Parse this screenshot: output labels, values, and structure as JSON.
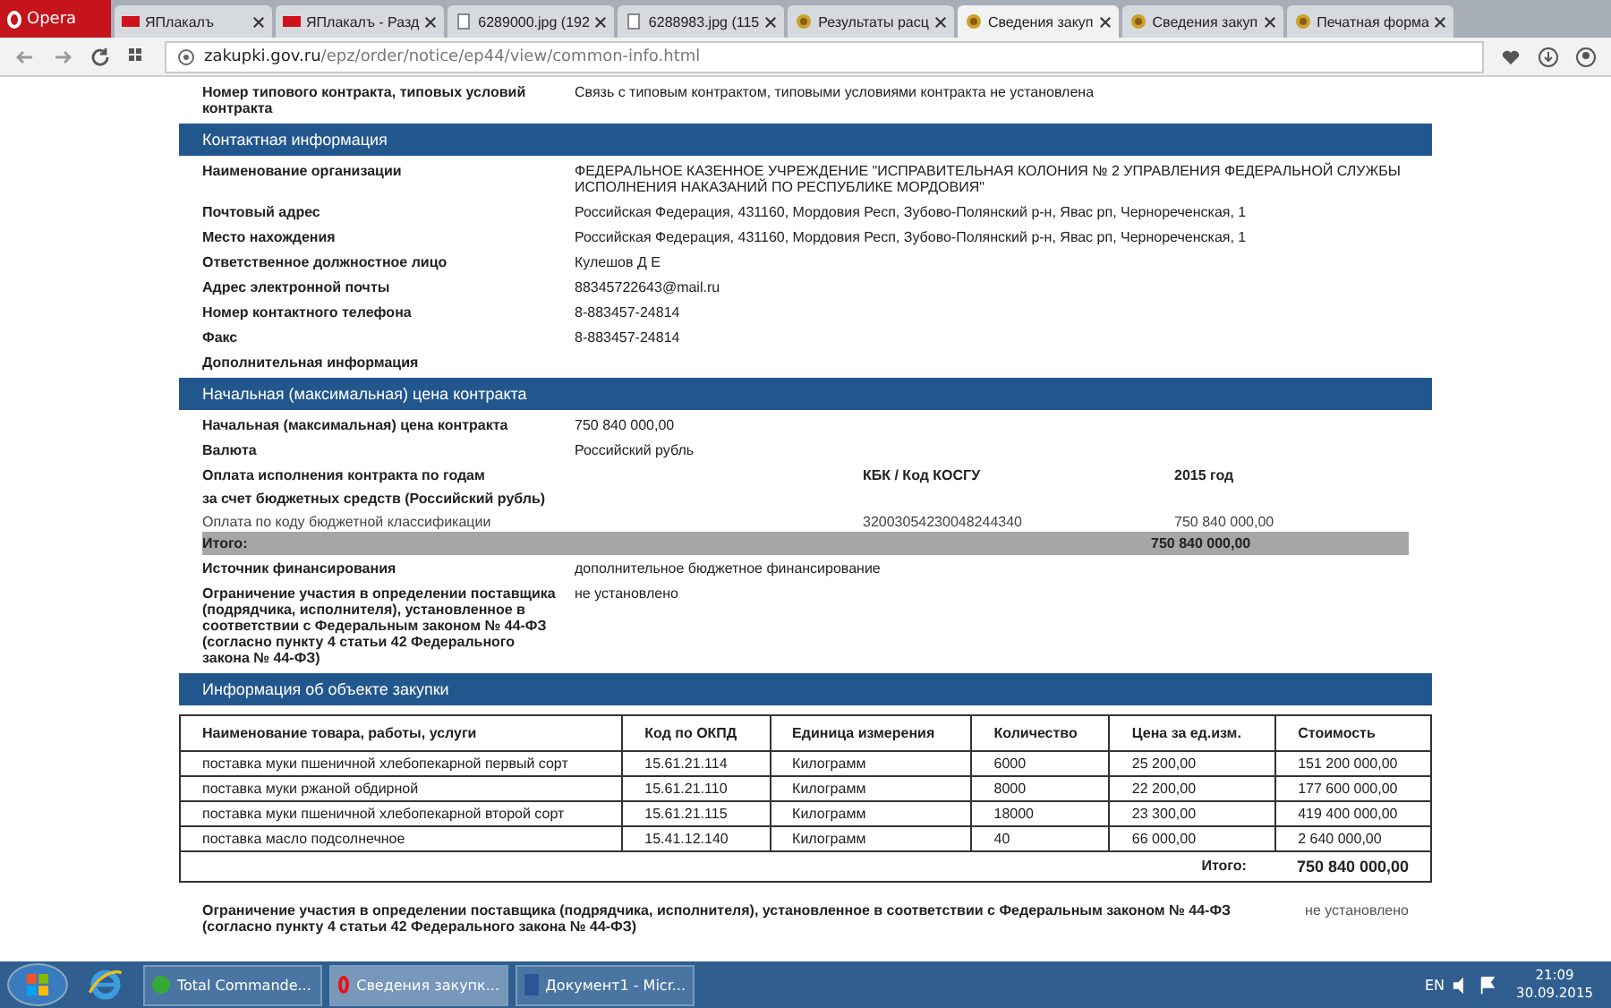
{
  "browser": {
    "menu_label": "Opera",
    "tabs": [
      {
        "label": "ЯПлакалъ",
        "selected": false,
        "kind": "yap"
      },
      {
        "label": "ЯПлакалъ - Разд",
        "selected": false,
        "kind": "yap"
      },
      {
        "label": "6289000.jpg (192",
        "selected": false,
        "kind": "page"
      },
      {
        "label": "6288983.jpg (115",
        "selected": false,
        "kind": "page"
      },
      {
        "label": "Результаты расц",
        "selected": false,
        "kind": "emblem"
      },
      {
        "label": "Сведения закуп",
        "selected": true,
        "kind": "emblem"
      },
      {
        "label": "Сведения закуп",
        "selected": false,
        "kind": "emblem"
      },
      {
        "label": "Печатная форма",
        "selected": false,
        "kind": "emblem"
      }
    ],
    "url_host": "zakupki.gov.ru",
    "url_path": "/epz/order/notice/ep44/view/common-info.html"
  },
  "top_row": {
    "label": "Номер типового контракта, типовых условий контракта",
    "value": "Связь с типовым контрактом, типовыми условиями контракта не установлена"
  },
  "contact": {
    "title": "Контактная информация",
    "rows": [
      {
        "label": "Наименование организации",
        "value": "ФЕДЕРАЛЬНОЕ КАЗЕННОЕ УЧРЕЖДЕНИЕ \"ИСПРАВИТЕЛЬНАЯ КОЛОНИЯ № 2 УПРАВЛЕНИЯ ФЕДЕРАЛЬНОЙ СЛУЖБЫ ИСПОЛНЕНИЯ НАКАЗАНИЙ ПО РЕСПУБЛИКЕ МОРДОВИЯ\""
      },
      {
        "label": "Почтовый адрес",
        "value": "Российская Федерация, 431160, Мордовия Респ, Зубово-Полянский р-н, Явас рп, Чернореченская, 1"
      },
      {
        "label": "Место нахождения",
        "value": "Российская Федерация, 431160, Мордовия Респ, Зубово-Полянский р-н, Явас рп, Чернореченская, 1"
      },
      {
        "label": "Ответственное должностное лицо",
        "value": "Кулешов Д Е"
      },
      {
        "label": "Адрес электронной почты",
        "value": "88345722643@mail.ru"
      },
      {
        "label": "Номер контактного телефона",
        "value": "8-883457-24814"
      },
      {
        "label": "Факс",
        "value": "8-883457-24814"
      },
      {
        "label": "Дополнительная информация"
      }
    ]
  },
  "price": {
    "title": "Начальная (максимальная) цена контракта",
    "rows": [
      {
        "label": "Начальная (максимальная) цена контракта",
        "value": "750 840 000,00"
      },
      {
        "label": "Валюта",
        "value": "Российский рубль"
      }
    ],
    "payment": {
      "heading": "Оплата исполнения контракта по годам",
      "code_heading": "КБК / Код КОСГУ",
      "year_heading": "2015 год",
      "subheading": "за счет бюджетных средств (Российский рубль)",
      "row": {
        "label": "Оплата по коду бюджетной классификации",
        "code": "32003054230048244340",
        "amount": "750 840 000,00"
      },
      "total_label": "Итого:",
      "total": "750 840 000,00"
    },
    "rows_after": [
      {
        "label": "Источник финансирования",
        "value": "дополнительное бюджетное финансирование"
      },
      {
        "label": "Ограничение участия в определении поставщика (подрядчика, исполнителя), установленное в соответствии с Федеральным законом № 44-ФЗ (согласно пункту 4 статьи 42 Федерального закона № 44-ФЗ)",
        "value": "не установлено"
      }
    ]
  },
  "object": {
    "title": "Информация об объекте закупки",
    "columns": [
      "Наименование товара, работы, услуги",
      "Код по ОКПД",
      "Единица измерения",
      "Количество",
      "Цена за ед.изм.",
      "Стоимость"
    ],
    "rows": [
      [
        "поставка муки пшеничной хлебопекарной первый сорт",
        "15.61.21.114",
        "Килограмм",
        "6000",
        "25 200,00",
        "151 200 000,00"
      ],
      [
        "поставка муки ржаной обдирной",
        "15.61.21.110",
        "Килограмм",
        "8000",
        "22 200,00",
        "177 600 000,00"
      ],
      [
        "поставка муки пшеничной хлебопекарной второй сорт",
        "15.61.21.115",
        "Килограмм",
        "18000",
        "23 300,00",
        "419 400 000,00"
      ],
      [
        "поставка масло подсолнечное",
        "15.41.12.140",
        "Килограмм",
        "40",
        "66 000,00",
        "2 640 000,00"
      ]
    ],
    "total_label": "Итого:",
    "total": "750 840 000,00"
  },
  "bottom_row": {
    "label": "Ограничение участия в определении поставщика (подрядчика, исполнителя), установленное в соответствии с Федеральным законом № 44-ФЗ (согласно пункту 4 статьи 42 Федерального закона № 44-ФЗ)",
    "value": "не установлено"
  },
  "taskbar": {
    "items": [
      {
        "label": "Total Commande...",
        "selected": false,
        "kind": "tc"
      },
      {
        "label": "Сведения закупк...",
        "selected": true,
        "kind": "opera"
      },
      {
        "label": "Документ1 - Micr...",
        "selected": false,
        "kind": "word"
      }
    ],
    "language": "EN",
    "time": "21:09",
    "date": "30.09.2015"
  }
}
